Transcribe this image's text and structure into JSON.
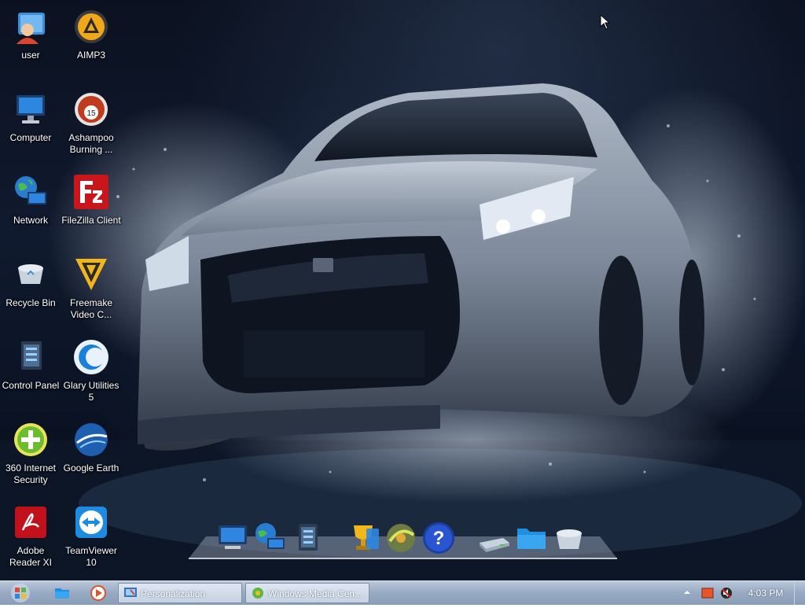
{
  "desktop_icons": [
    {
      "label": "user",
      "icon": "user-folder-icon"
    },
    {
      "label": "AIMP3",
      "icon": "aimp-icon"
    },
    {
      "label": "Computer",
      "icon": "computer-icon"
    },
    {
      "label": "Ashampoo Burning ...",
      "icon": "ashampoo-icon"
    },
    {
      "label": "Network",
      "icon": "network-icon"
    },
    {
      "label": "FileZilla Client",
      "icon": "filezilla-icon"
    },
    {
      "label": "Recycle Bin",
      "icon": "recycle-bin-icon"
    },
    {
      "label": "Freemake Video C...",
      "icon": "freemake-icon"
    },
    {
      "label": "Control Panel",
      "icon": "control-panel-icon"
    },
    {
      "label": "Glary Utilities 5",
      "icon": "glary-icon"
    },
    {
      "label": "360 Internet Security",
      "icon": "360-security-icon"
    },
    {
      "label": "Google Earth",
      "icon": "google-earth-icon"
    },
    {
      "label": "Adobe Reader XI",
      "icon": "adobe-reader-icon"
    },
    {
      "label": "TeamViewer 10",
      "icon": "teamviewer-icon"
    }
  ],
  "dock_items": [
    "computer-icon",
    "network-icon",
    "control-panel-icon",
    "trophy-icon",
    "media-icon",
    "help-icon",
    "drive-icon",
    "folder-icon",
    "recycle-bin-icon"
  ],
  "taskbar": {
    "start_icon": "windows-logo-icon",
    "quick_launch": [
      "explorer-icon",
      "media-player-icon"
    ],
    "buttons": [
      {
        "label": "Personalization",
        "icon": "personalization-icon"
      },
      {
        "label": "Windows Media Cen...",
        "icon": "media-center-icon"
      }
    ],
    "tray_icons": [
      "show-hidden-icons-arrow",
      "flag-icon",
      "volume-icon"
    ],
    "clock": "4:03 PM"
  },
  "colors": {
    "taskbar": "#9aacc4",
    "desktop_bg": "#0b1120",
    "car": "#8b97a8"
  }
}
